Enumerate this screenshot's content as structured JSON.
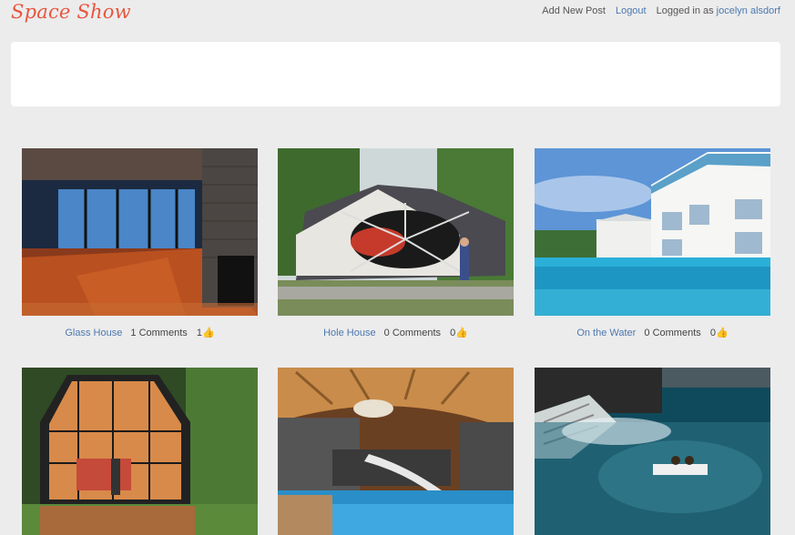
{
  "header": {
    "brand": "Space Show",
    "add_post": "Add New Post",
    "logout": "Logout",
    "logged_in_prefix": "Logged in as",
    "username": "jocelyn alsdorf"
  },
  "posts": [
    {
      "title": "Glass House",
      "comments": "1 Comments",
      "likes": "1"
    },
    {
      "title": "Hole House",
      "comments": "0 Comments",
      "likes": "0"
    },
    {
      "title": "On the Water",
      "comments": "0 Comments",
      "likes": "0"
    },
    {
      "title": "",
      "comments": "",
      "likes": ""
    },
    {
      "title": "",
      "comments": "",
      "likes": ""
    },
    {
      "title": "",
      "comments": "",
      "likes": ""
    }
  ],
  "colors": {
    "brand": "#e8553f",
    "link": "#4d79b0",
    "background": "#ececec"
  }
}
